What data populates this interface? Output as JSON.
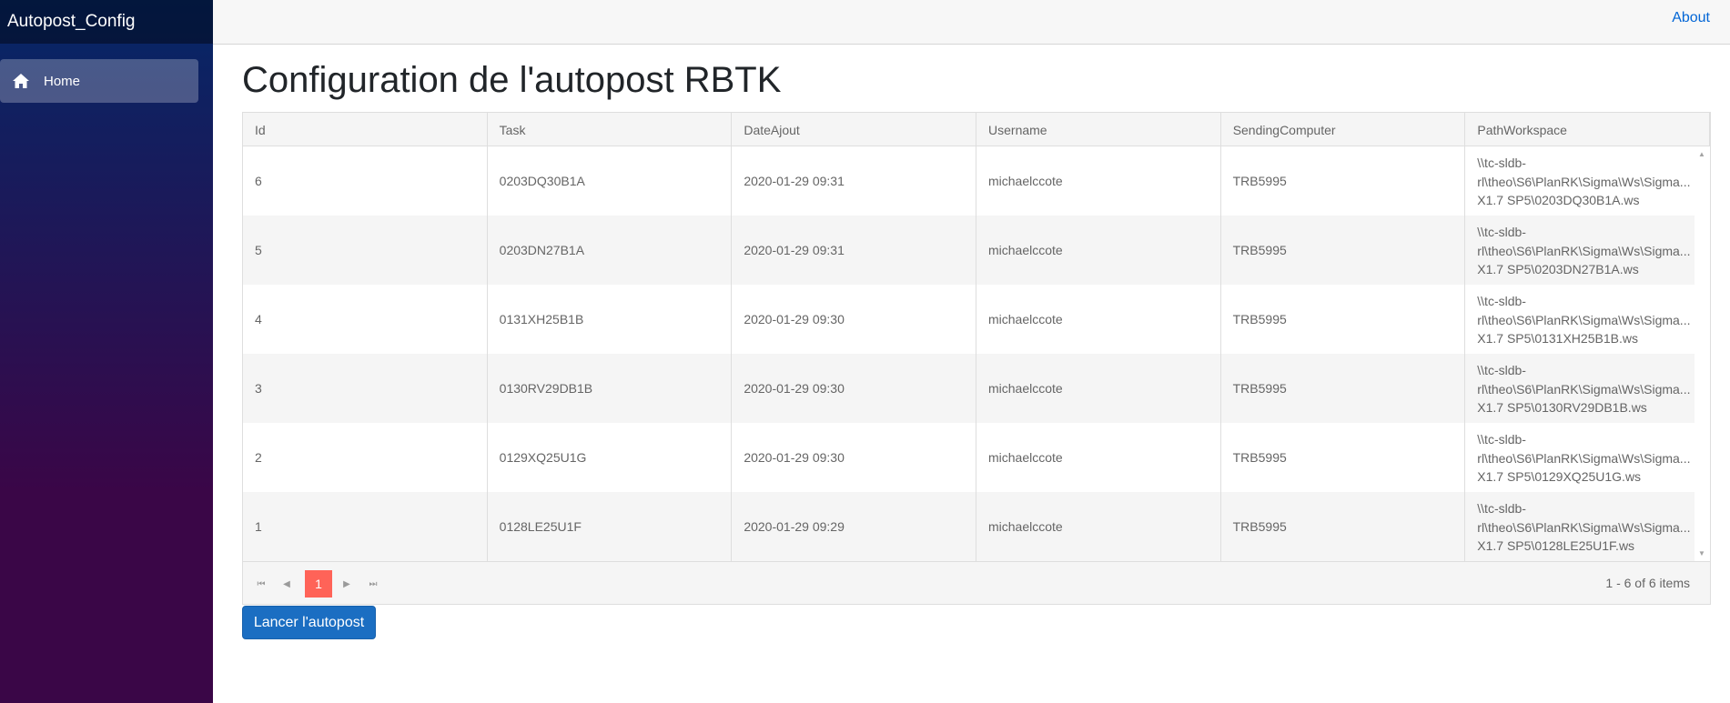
{
  "app": {
    "brand": "Autopost_Config"
  },
  "nav": {
    "items": [
      {
        "label": "Home",
        "icon": "home-icon"
      }
    ]
  },
  "top": {
    "about": "About"
  },
  "main": {
    "title": "Configuration de l'autopost RBTK"
  },
  "grid": {
    "columns": [
      "Id",
      "Task",
      "DateAjout",
      "Username",
      "SendingComputer",
      "PathWorkspace"
    ],
    "rows": [
      {
        "id": "6",
        "task": "0203DQ30B1A",
        "date": "2020-01-29 09:31",
        "user": "michaelccote",
        "computer": "TRB5995",
        "path1": "\\\\tc-sldb-",
        "path2": "rl\\theo\\S6\\PlanRK\\Sigma\\Ws\\Sigma...",
        "path3": "X1.7 SP5\\0203DQ30B1A.ws"
      },
      {
        "id": "5",
        "task": "0203DN27B1A",
        "date": "2020-01-29 09:31",
        "user": "michaelccote",
        "computer": "TRB5995",
        "path1": "\\\\tc-sldb-",
        "path2": "rl\\theo\\S6\\PlanRK\\Sigma\\Ws\\Sigma...",
        "path3": "X1.7 SP5\\0203DN27B1A.ws"
      },
      {
        "id": "4",
        "task": "0131XH25B1B",
        "date": "2020-01-29 09:30",
        "user": "michaelccote",
        "computer": "TRB5995",
        "path1": "\\\\tc-sldb-",
        "path2": "rl\\theo\\S6\\PlanRK\\Sigma\\Ws\\Sigma...",
        "path3": "X1.7 SP5\\0131XH25B1B.ws"
      },
      {
        "id": "3",
        "task": "0130RV29DB1B",
        "date": "2020-01-29 09:30",
        "user": "michaelccote",
        "computer": "TRB5995",
        "path1": "\\\\tc-sldb-",
        "path2": "rl\\theo\\S6\\PlanRK\\Sigma\\Ws\\Sigma...",
        "path3": "X1.7 SP5\\0130RV29DB1B.ws"
      },
      {
        "id": "2",
        "task": "0129XQ25U1G",
        "date": "2020-01-29 09:30",
        "user": "michaelccote",
        "computer": "TRB5995",
        "path1": "\\\\tc-sldb-",
        "path2": "rl\\theo\\S6\\PlanRK\\Sigma\\Ws\\Sigma...",
        "path3": "X1.7 SP5\\0129XQ25U1G.ws"
      },
      {
        "id": "1",
        "task": "0128LE25U1F",
        "date": "2020-01-29 09:29",
        "user": "michaelccote",
        "computer": "TRB5995",
        "path1": "\\\\tc-sldb-",
        "path2": "rl\\theo\\S6\\PlanRK\\Sigma\\Ws\\Sigma...",
        "path3": "X1.7 SP5\\0128LE25U1F.ws"
      }
    ]
  },
  "pager": {
    "current_page": "1",
    "info": "1 - 6 of 6 items"
  },
  "actions": {
    "launch": "Lancer l'autopost"
  },
  "colors": {
    "sidebar_top": "#052767",
    "sidebar_bottom": "#3a0647",
    "page_active": "#ff6358",
    "button": "#1b6ec2",
    "link": "#0366d6"
  }
}
